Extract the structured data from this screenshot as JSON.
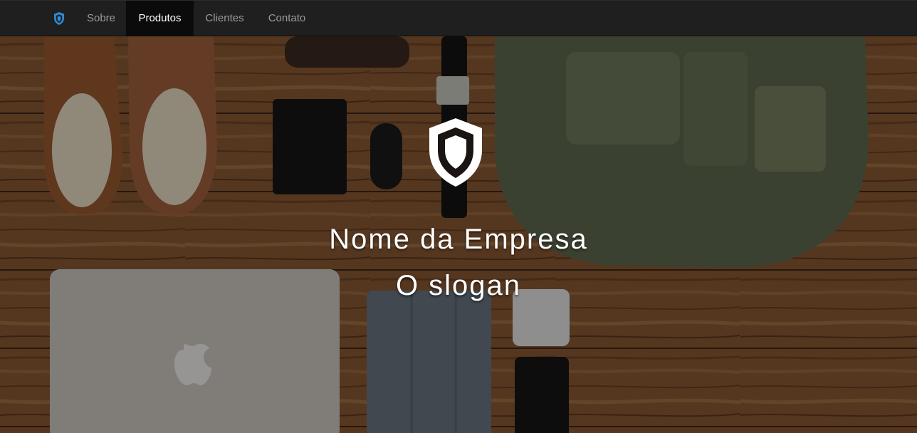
{
  "navbar": {
    "brand_icon": "shield-icon",
    "brand_color": "#2e8bd8",
    "items": [
      {
        "label": "Sobre",
        "active": false
      },
      {
        "label": "Produtos",
        "active": true
      },
      {
        "label": "Clientes",
        "active": false
      },
      {
        "label": "Contato",
        "active": false
      }
    ]
  },
  "hero": {
    "logo_icon": "shield-icon",
    "title": "Nome da Empresa",
    "slogan": "O slogan",
    "background": "flat-lay-photo-on-wood-floor"
  }
}
